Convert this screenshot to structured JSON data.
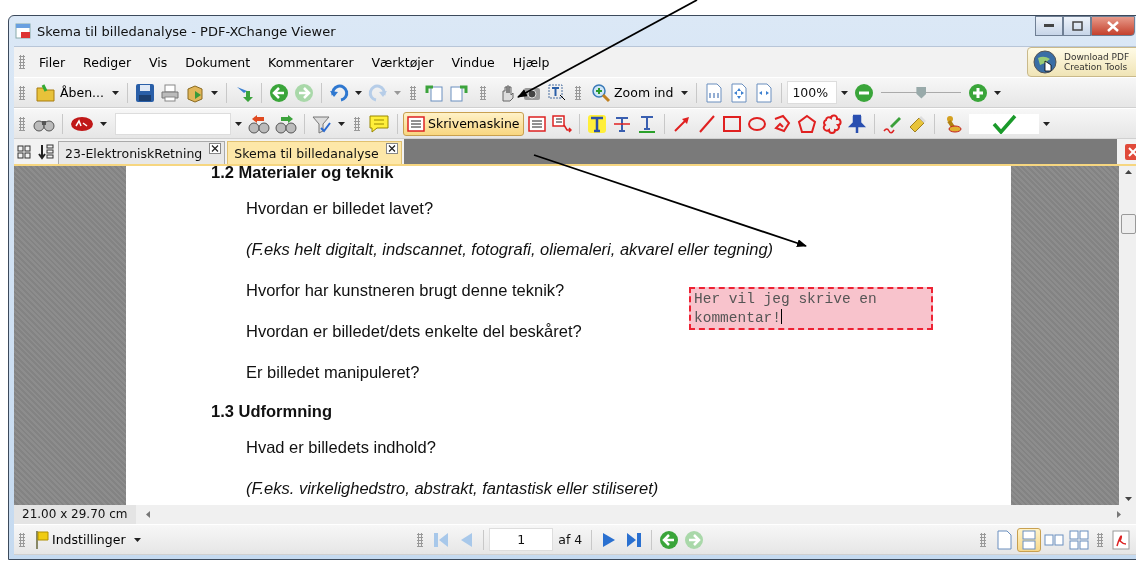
{
  "window": {
    "title": "Skema til billedanalyse - PDF-XChange Viewer"
  },
  "menu": [
    "Filer",
    "Rediger",
    "Vis",
    "Dokument",
    "Kommentarer",
    "Værktøjer",
    "Vindue",
    "Hjælp"
  ],
  "promo": {
    "lines": [
      "Download PDF",
      "Creation Tools"
    ]
  },
  "toolbar_1": {
    "open_label": "Åben...",
    "zoom_label": "Zoom ind",
    "zoom_value": "100%",
    "zoom_slider": {
      "level": 0.5
    }
  },
  "toolbar_2": {
    "typewriter": {
      "label": "Skrivemaskine",
      "selected": true
    }
  },
  "tabs": [
    {
      "label": "23-ElektroniskRetning",
      "selected": false
    },
    {
      "label": "Skema til billedanalyse",
      "selected": true
    }
  ],
  "document": {
    "blocks": [
      {
        "kind": "heading",
        "text": "1.2 Materialer og teknik"
      },
      {
        "kind": "question",
        "text": "Hvordan er billedet lavet?"
      },
      {
        "kind": "hint",
        "text": "(F.eks helt digitalt, indscannet, fotografi, oliemaleri, akvarel eller tegning)"
      },
      {
        "kind": "question",
        "text": "Hvorfor har kunstneren brugt denne teknik?"
      },
      {
        "kind": "question",
        "text": "Hvordan er billedet/dets enkelte del beskåret?"
      },
      {
        "kind": "question",
        "text": "Er billedet manipuleret?"
      },
      {
        "kind": "heading",
        "text": "1.3 Udformning"
      },
      {
        "kind": "question",
        "text": "Hvad er billedets indhold?"
      },
      {
        "kind": "hint",
        "text": "(F.eks. virkelighedstro, abstrakt, fantastisk eller stiliseret)"
      }
    ]
  },
  "comment": {
    "text": "Her vil jeg skrive en kommentar!"
  },
  "status": {
    "page_size": "21.00 x 29.70 cm"
  },
  "bottom": {
    "settings_label": "Indstillinger",
    "page": "1",
    "page_count": "af 4",
    "views": [
      {
        "kind": "single",
        "selected": false
      },
      {
        "kind": "continuous",
        "selected": true
      },
      {
        "kind": "facing",
        "selected": false
      },
      {
        "kind": "facing-continuous",
        "selected": false
      }
    ]
  }
}
